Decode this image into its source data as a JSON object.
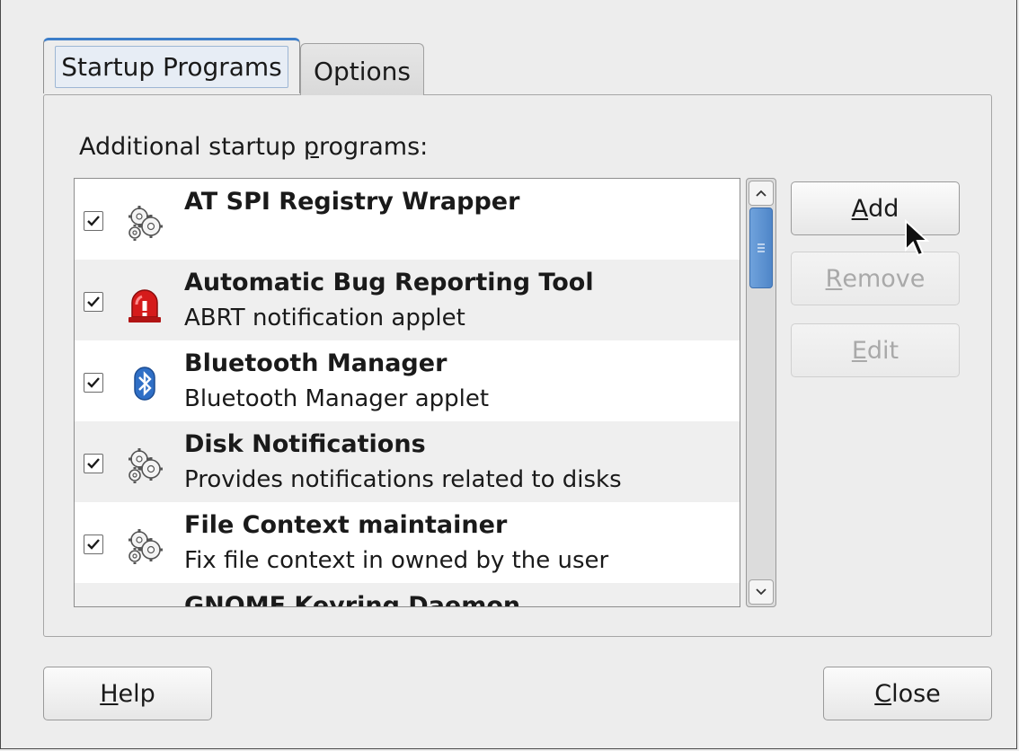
{
  "tabs": [
    {
      "label": "Startup Programs",
      "active": true
    },
    {
      "label": "Options",
      "active": false
    }
  ],
  "section_label": {
    "pre": "Additional startup ",
    "mnemonic": "p",
    "post": "rograms:"
  },
  "programs": [
    {
      "name": "AT SPI Registry Wrapper",
      "description": "",
      "checked": true,
      "icon": "gears-icon"
    },
    {
      "name": "Automatic Bug Reporting Tool",
      "description": "ABRT notification applet",
      "checked": true,
      "icon": "alarm-siren-icon"
    },
    {
      "name": "Bluetooth Manager",
      "description": "Bluetooth Manager applet",
      "checked": true,
      "icon": "bluetooth-icon"
    },
    {
      "name": "Disk Notifications",
      "description": "Provides notifications related to disks",
      "checked": true,
      "icon": "gears-icon"
    },
    {
      "name": "File Context maintainer",
      "description": "Fix file context in owned by the user",
      "checked": true,
      "icon": "gears-icon"
    },
    {
      "name": "GNOME Keyring Daemon",
      "description": "",
      "checked": true,
      "icon": "gears-icon"
    }
  ],
  "buttons": {
    "add": {
      "mnemonic": "A",
      "rest": "dd",
      "enabled": true
    },
    "remove": {
      "mnemonic": "R",
      "rest": "emove",
      "enabled": false
    },
    "edit": {
      "mnemonic": "E",
      "rest": "dit",
      "enabled": false
    },
    "help": {
      "mnemonic": "H",
      "rest": "elp",
      "enabled": true
    },
    "close": {
      "mnemonic": "C",
      "rest": "lose",
      "enabled": true
    }
  },
  "colors": {
    "tab_accent": "#3d7ec9",
    "scroll_thumb": "#5a8fd0",
    "abrt_red": "#d51b1b",
    "bluetooth_blue": "#2f6fc6"
  }
}
